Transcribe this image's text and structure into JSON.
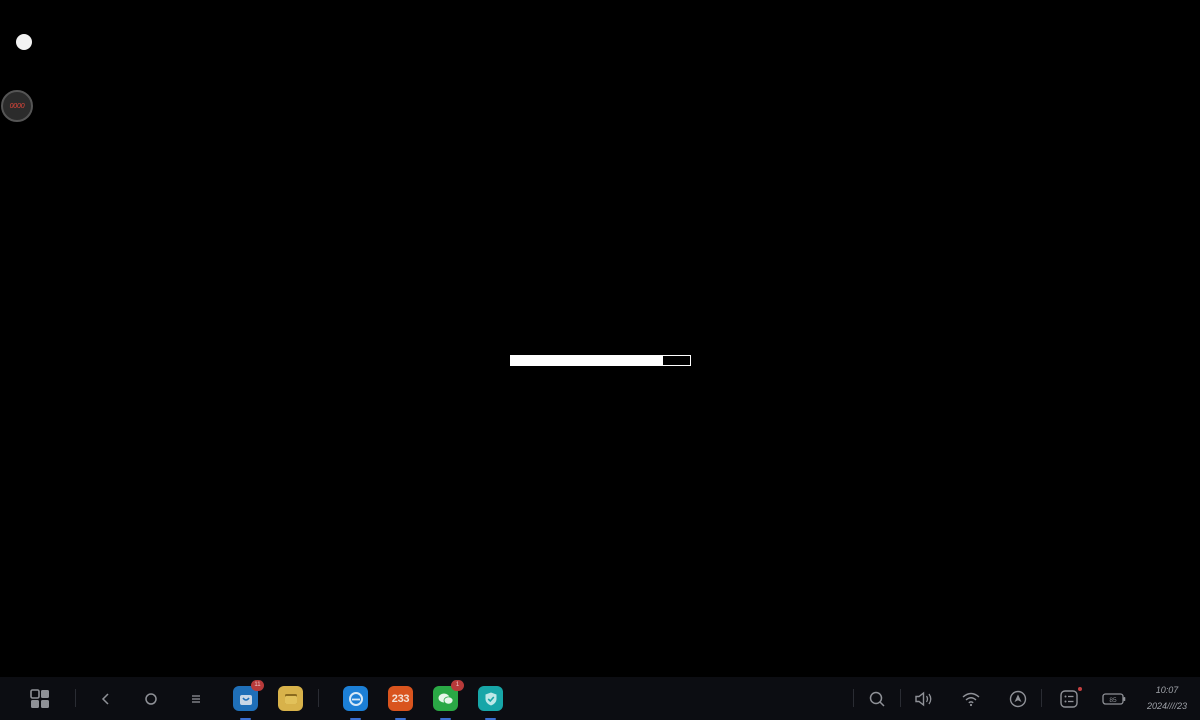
{
  "overlay": {
    "float_ball_label": "0000"
  },
  "loading": {
    "progress_fraction": 0.85
  },
  "taskbar": {
    "apps": [
      {
        "name": "app-store",
        "color": "#1f6fb8",
        "badge": "11"
      },
      {
        "name": "file-manager",
        "color": "#d8b24a",
        "badge": ""
      },
      {
        "name": "browser",
        "color": "#1c7fd6",
        "badge": ""
      },
      {
        "name": "233",
        "color": "#d9541e",
        "label": "233",
        "badge": ""
      },
      {
        "name": "wechat",
        "color": "#2aa845",
        "badge": "1"
      },
      {
        "name": "security",
        "color": "#17a6a8",
        "badge": ""
      }
    ],
    "clock": {
      "time": "10:07",
      "date": "2024////23"
    },
    "battery_label": "85"
  },
  "colors": {
    "background": "#000000",
    "taskbar": "#0c0d12",
    "icon_gray": "#8f9197",
    "accent_underline": "#3b6fd1"
  }
}
